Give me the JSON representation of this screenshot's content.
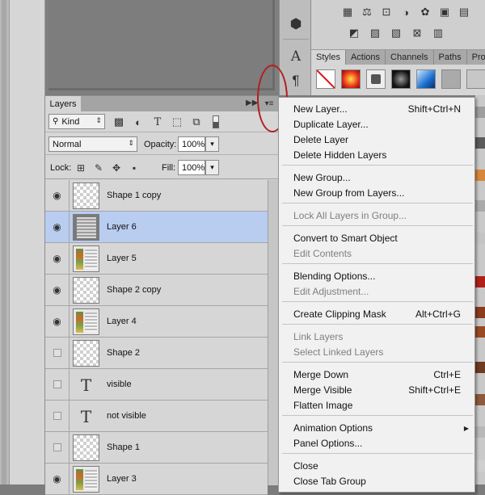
{
  "layers_panel": {
    "tab_label": "Layers",
    "filter_kind": "Kind",
    "blend_mode": "Normal",
    "opacity_label": "Opacity:",
    "opacity_value": "100%",
    "lock_label": "Lock:",
    "fill_label": "Fill:",
    "fill_value": "100%",
    "layers": [
      {
        "name": "Shape 1 copy",
        "visible": true,
        "thumb": "transparent",
        "selected": false
      },
      {
        "name": "Layer 6",
        "visible": true,
        "thumb": "dark",
        "selected": true
      },
      {
        "name": "Layer 5",
        "visible": true,
        "thumb": "image",
        "selected": false
      },
      {
        "name": "Shape 2 copy",
        "visible": true,
        "thumb": "transparent",
        "selected": false
      },
      {
        "name": "Layer 4",
        "visible": true,
        "thumb": "image",
        "selected": false
      },
      {
        "name": "Shape 2",
        "visible": false,
        "thumb": "transparent",
        "selected": false
      },
      {
        "name": "visible",
        "visible": false,
        "thumb": "text",
        "selected": false
      },
      {
        "name": "not visible",
        "visible": false,
        "thumb": "text",
        "selected": false
      },
      {
        "name": "Shape 1",
        "visible": false,
        "thumb": "transparent",
        "selected": false
      },
      {
        "name": "Layer 3",
        "visible": true,
        "thumb": "image",
        "selected": false
      }
    ]
  },
  "styles_panel": {
    "tabs": [
      "Styles",
      "Actions",
      "Channels",
      "Paths",
      "Prope"
    ],
    "active_tab": "Styles"
  },
  "icons": {
    "text_thumb_glyph": "T",
    "tool_type": "A",
    "tool_paragraph": "¶",
    "tool_3d": "⬢"
  },
  "menu": {
    "groups": [
      [
        {
          "label": "New Layer...",
          "shortcut": "Shift+Ctrl+N",
          "enabled": true
        },
        {
          "label": "Duplicate Layer...",
          "shortcut": "",
          "enabled": true
        },
        {
          "label": "Delete Layer",
          "shortcut": "",
          "enabled": true
        },
        {
          "label": "Delete Hidden Layers",
          "shortcut": "",
          "enabled": true
        }
      ],
      [
        {
          "label": "New Group...",
          "shortcut": "",
          "enabled": true
        },
        {
          "label": "New Group from Layers...",
          "shortcut": "",
          "enabled": true
        }
      ],
      [
        {
          "label": "Lock All Layers in Group...",
          "shortcut": "",
          "enabled": false
        }
      ],
      [
        {
          "label": "Convert to Smart Object",
          "shortcut": "",
          "enabled": true
        },
        {
          "label": "Edit Contents",
          "shortcut": "",
          "enabled": false
        }
      ],
      [
        {
          "label": "Blending Options...",
          "shortcut": "",
          "enabled": true
        },
        {
          "label": "Edit Adjustment...",
          "shortcut": "",
          "enabled": false
        }
      ],
      [
        {
          "label": "Create Clipping Mask",
          "shortcut": "Alt+Ctrl+G",
          "enabled": true
        }
      ],
      [
        {
          "label": "Link Layers",
          "shortcut": "",
          "enabled": false
        },
        {
          "label": "Select Linked Layers",
          "shortcut": "",
          "enabled": false
        }
      ],
      [
        {
          "label": "Merge Down",
          "shortcut": "Ctrl+E",
          "enabled": true
        },
        {
          "label": "Merge Visible",
          "shortcut": "Shift+Ctrl+E",
          "enabled": true
        },
        {
          "label": "Flatten Image",
          "shortcut": "",
          "enabled": true
        }
      ],
      [
        {
          "label": "Animation Options",
          "shortcut": "",
          "enabled": true,
          "submenu": true
        },
        {
          "label": "Panel Options...",
          "shortcut": "",
          "enabled": true
        }
      ],
      [
        {
          "label": "Close",
          "shortcut": "",
          "enabled": true
        },
        {
          "label": "Close Tab Group",
          "shortcut": "",
          "enabled": true
        }
      ]
    ]
  },
  "colors": {
    "selection": "#b9cdf1",
    "annotation_circle": "#b21e1e",
    "disabled_text": "#7f7f7f"
  }
}
